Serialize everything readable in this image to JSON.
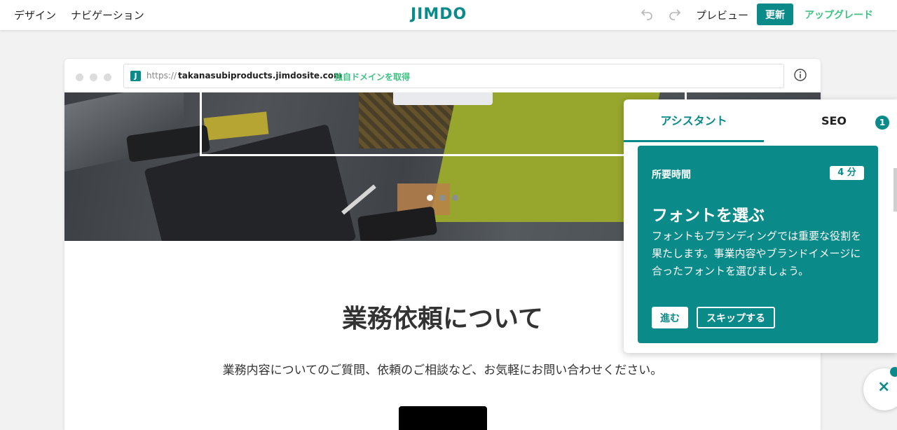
{
  "colors": {
    "accent": "#0b8a8a",
    "accent_light": "#5ec58e",
    "upgrade": "#3ec382"
  },
  "topbar": {
    "design_label": "デザイン",
    "navigation_label": "ナビゲーション",
    "logo_text": "JIMDO",
    "undo_icon": "undo-icon",
    "redo_icon": "redo-icon",
    "preview_label": "プレビュー",
    "update_label": "更新",
    "upgrade_label": "アップグレード"
  },
  "browser": {
    "url_icon_letter": "J",
    "url_protocol": "https://",
    "url_host": "takanasubiproducts.jimdosite.com",
    "domain_link_label": "独自ドメインを取得",
    "info_icon": "info-icon"
  },
  "hero": {
    "slide_count": 3,
    "active_slide": 1
  },
  "page": {
    "title": "業務依頼について",
    "description": "業務内容についてのご質問、依頼のご相談など、お気軽にお問い合わせください。"
  },
  "assistant": {
    "tab_assistant": "アシスタント",
    "tab_seo": "SEO",
    "seo_badge": "1",
    "card": {
      "time_label": "所要時間",
      "time_value": "4 分",
      "title": "フォントを選ぶ",
      "body": "フォントもブランディングでは重要な役割を果たします。事業内容やブランドイメージに合ったフォントを選びましょう。",
      "next_label": "進む",
      "skip_label": "スキップする"
    }
  },
  "fab": {
    "icon": "close-icon",
    "glyph": "×"
  }
}
